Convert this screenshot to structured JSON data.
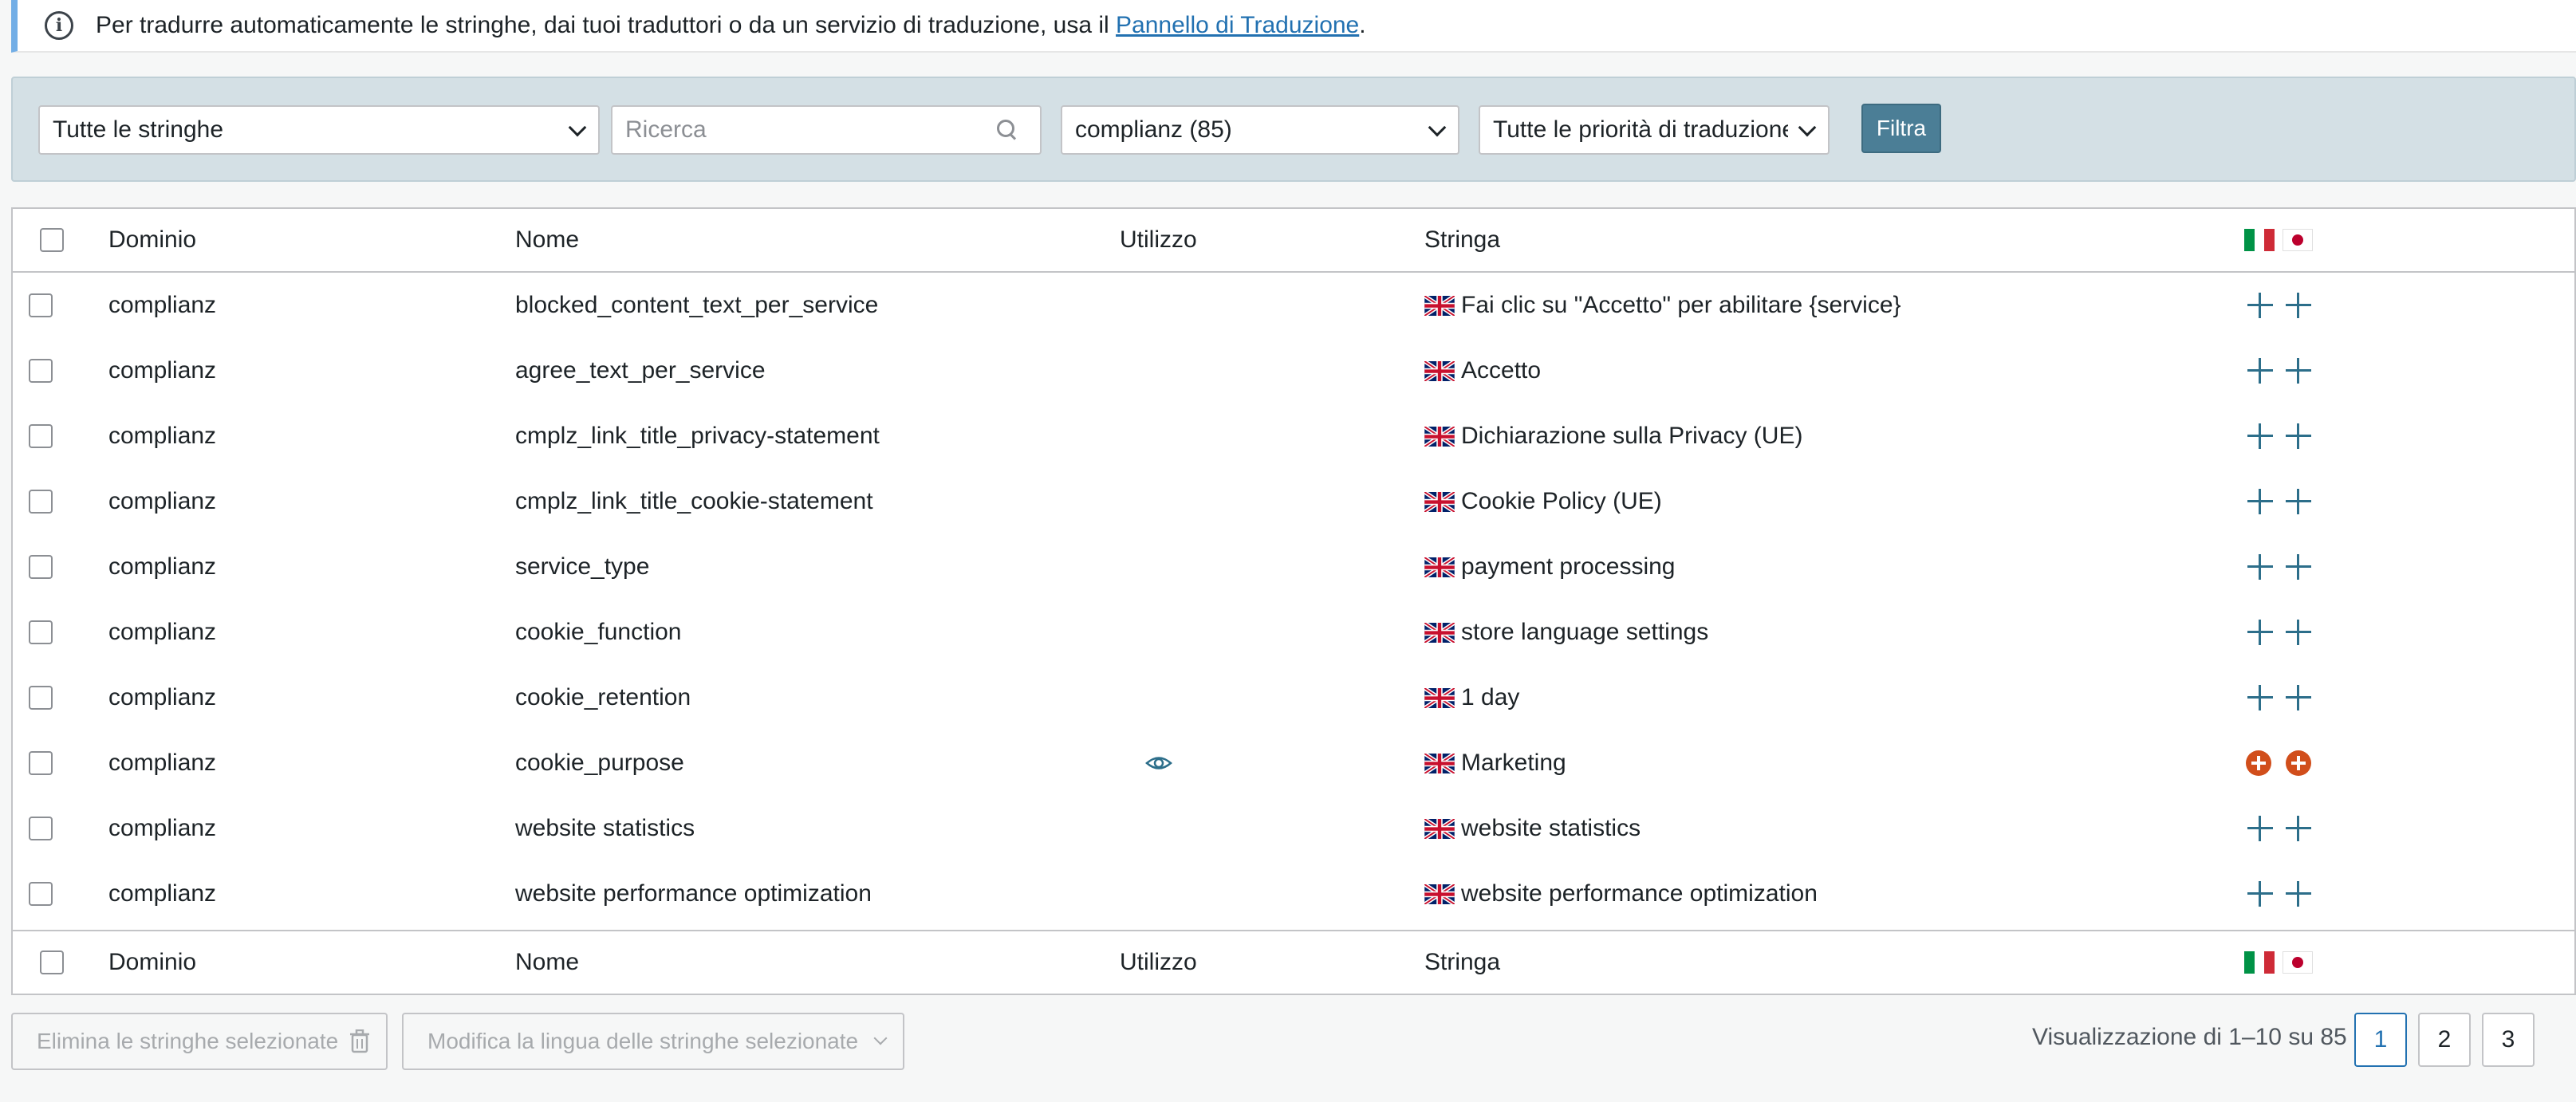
{
  "notice": {
    "text": "Per tradurre automaticamente le stringhe, dai tuoi traduttori o da un servizio di traduzione, usa il",
    "link_label": "Pannello di Traduzione",
    "suffix": "."
  },
  "filters": {
    "strings_select": "Tutte le stringhe",
    "search_placeholder": "Ricerca",
    "domain_select": "complianz (85)",
    "priority_select": "Tutte le priorità di traduzione",
    "filter_button": "Filtra"
  },
  "table": {
    "columns": {
      "domain": "Dominio",
      "name": "Nome",
      "usage": "Utilizzo",
      "string": "Stringa"
    },
    "rows": [
      {
        "domain": "complianz",
        "name": "blocked_content_text_per_service",
        "string": "Fai clic su \"Accetto\" per abilitare {service}",
        "usage": false,
        "status": "add"
      },
      {
        "domain": "complianz",
        "name": "agree_text_per_service",
        "string": "Accetto",
        "usage": false,
        "status": "add"
      },
      {
        "domain": "complianz",
        "name": "cmplz_link_title_privacy-statement",
        "string": "Dichiarazione sulla Privacy (UE)",
        "usage": false,
        "status": "add"
      },
      {
        "domain": "complianz",
        "name": "cmplz_link_title_cookie-statement",
        "string": "Cookie Policy (UE)",
        "usage": false,
        "status": "add"
      },
      {
        "domain": "complianz",
        "name": "service_type",
        "string": "payment processing",
        "usage": false,
        "status": "add"
      },
      {
        "domain": "complianz",
        "name": "cookie_function",
        "string": "store language settings",
        "usage": false,
        "status": "add"
      },
      {
        "domain": "complianz",
        "name": "cookie_retention",
        "string": "1 day",
        "usage": false,
        "status": "add"
      },
      {
        "domain": "complianz",
        "name": "cookie_purpose",
        "string": "Marketing",
        "usage": true,
        "status": "needs-update"
      },
      {
        "domain": "complianz",
        "name": "website statistics",
        "string": "website statistics",
        "usage": false,
        "status": "add"
      },
      {
        "domain": "complianz",
        "name": "website performance optimization",
        "string": "website performance optimization",
        "usage": false,
        "status": "add"
      }
    ]
  },
  "bulk_actions": {
    "delete_label": "Elimina le stringhe selezionate",
    "change_language_label": "Modifica la lingua delle stringhe selezionate"
  },
  "pagination": {
    "info": "Visualizzazione di 1–10 su 85",
    "pages": [
      "1",
      "2",
      "3"
    ],
    "current": "1"
  },
  "colors": {
    "accent": "#4b7e96",
    "plus_icon": "#2c6e8a",
    "needs_update": "#d14e1b",
    "link": "#2271b1"
  }
}
